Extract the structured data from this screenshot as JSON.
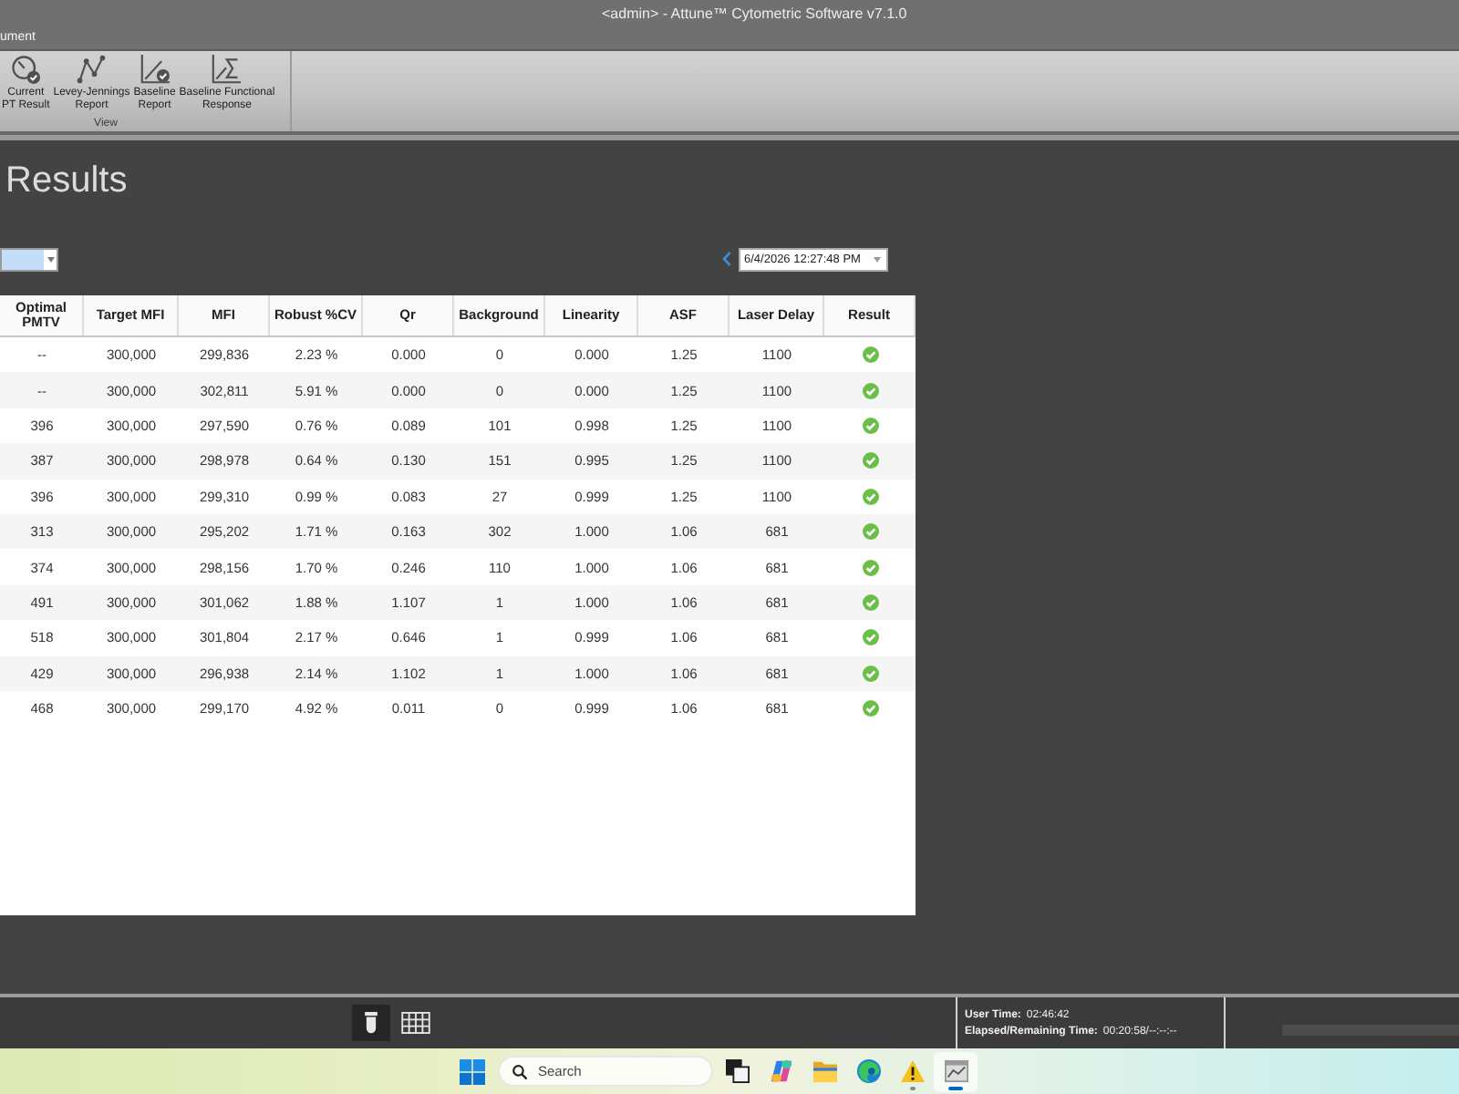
{
  "window": {
    "title": "<admin> - Attune™ Cytometric Software v7.1.0"
  },
  "menu": [
    {
      "label": "ument"
    }
  ],
  "ribbon": {
    "groups": [
      {
        "label": "View",
        "buttons": [
          {
            "label": "Current\nPT Result"
          },
          {
            "label": "Levey-Jennings\nReport"
          },
          {
            "label": "Baseline\nReport"
          },
          {
            "label": "Baseline Functional\nResponse"
          }
        ]
      }
    ]
  },
  "page": {
    "heading": "Results"
  },
  "date_selector": {
    "value": "6/4/2026 12:27:48 PM"
  },
  "table": {
    "columns": [
      "Optimal PMTV",
      "Target MFI",
      "MFI",
      "Robust %CV",
      "Qr",
      "Background",
      "Linearity",
      "ASF",
      "Laser Delay",
      "Result"
    ],
    "rows": [
      {
        "cells": [
          "--",
          "300,000",
          "299,836",
          "2.23 %",
          "0.000",
          "0",
          "0.000",
          "1.25",
          "1100"
        ],
        "passed": true
      },
      {
        "cells": [
          "--",
          "300,000",
          "302,811",
          "5.91 %",
          "0.000",
          "0",
          "0.000",
          "1.25",
          "1100"
        ],
        "passed": true
      },
      {
        "cells": [
          "396",
          "300,000",
          "297,590",
          "0.76 %",
          "0.089",
          "101",
          "0.998",
          "1.25",
          "1100"
        ],
        "passed": true
      },
      {
        "cells": [
          "387",
          "300,000",
          "298,978",
          "0.64 %",
          "0.130",
          "151",
          "0.995",
          "1.25",
          "1100"
        ],
        "passed": true
      },
      {
        "cells": [
          "396",
          "300,000",
          "299,310",
          "0.99 %",
          "0.083",
          "27",
          "0.999",
          "1.25",
          "1100"
        ],
        "passed": true
      },
      {
        "cells": [
          "313",
          "300,000",
          "295,202",
          "1.71 %",
          "0.163",
          "302",
          "1.000",
          "1.06",
          "681"
        ],
        "passed": true
      },
      {
        "cells": [
          "374",
          "300,000",
          "298,156",
          "1.70 %",
          "0.246",
          "110",
          "1.000",
          "1.06",
          "681"
        ],
        "passed": true
      },
      {
        "cells": [
          "491",
          "300,000",
          "301,062",
          "1.88 %",
          "1.107",
          "1",
          "1.000",
          "1.06",
          "681"
        ],
        "passed": true
      },
      {
        "cells": [
          "518",
          "300,000",
          "301,804",
          "2.17 %",
          "0.646",
          "1",
          "0.999",
          "1.06",
          "681"
        ],
        "passed": true
      },
      {
        "cells": [
          "429",
          "300,000",
          "296,938",
          "2.14 %",
          "1.102",
          "1",
          "1.000",
          "1.06",
          "681"
        ],
        "passed": true
      },
      {
        "cells": [
          "468",
          "300,000",
          "299,170",
          "4.92 %",
          "0.011",
          "0",
          "0.999",
          "1.06",
          "681"
        ],
        "passed": true
      }
    ]
  },
  "status_bar": {
    "views": [
      {
        "selected": true
      },
      {
        "selected": false
      }
    ],
    "user_time": {
      "label": "User Time:",
      "value": "02:46:42"
    },
    "elapsed_time": {
      "label": "Elapsed/Remaining Time:",
      "value": "00:20:58/--:--:--"
    }
  },
  "taskbar": {
    "search": {
      "placeholder": "Search"
    },
    "apps": [
      {
        "running": false,
        "selected": false
      },
      {
        "running": false,
        "selected": false
      },
      {
        "running": false,
        "selected": false
      },
      {
        "running": false,
        "selected": false
      },
      {
        "running": true,
        "selected": false
      },
      {
        "running": true,
        "selected": true
      }
    ]
  }
}
